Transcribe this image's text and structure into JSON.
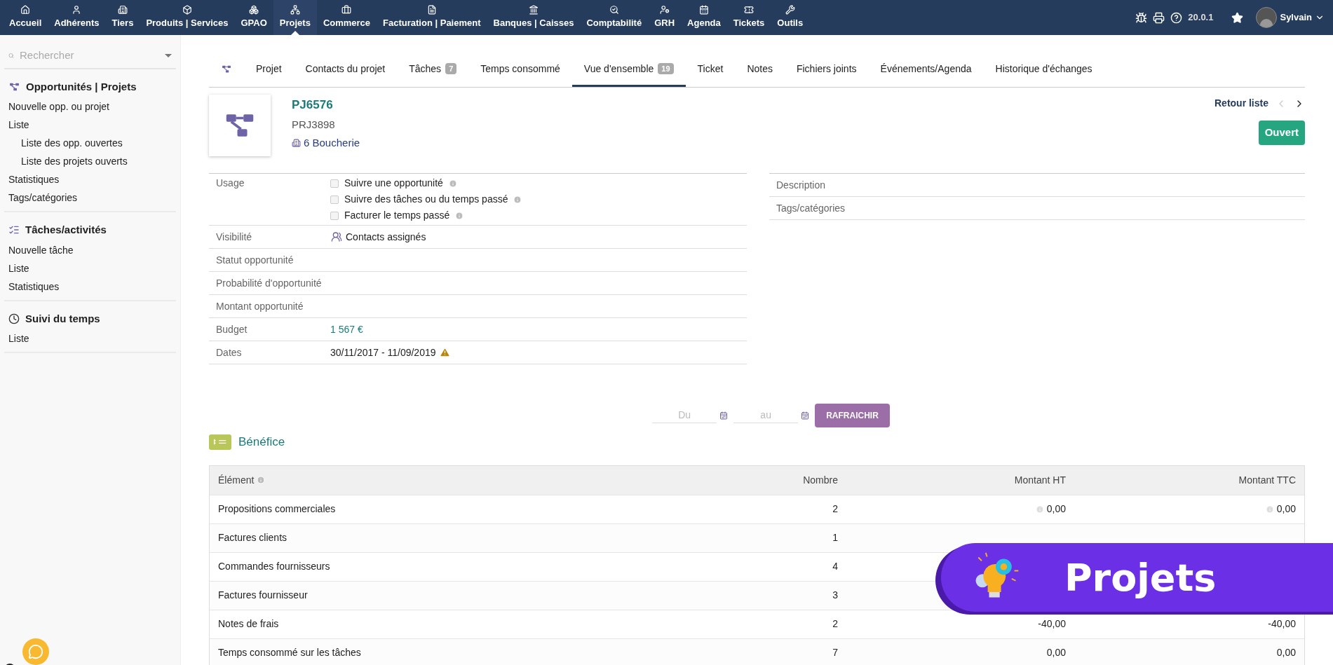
{
  "top_nav": {
    "items": [
      {
        "label": "Accueil",
        "selected": false
      },
      {
        "label": "Adhérents",
        "selected": false
      },
      {
        "label": "Tiers",
        "selected": false
      },
      {
        "label": "Produits | Services",
        "selected": false
      },
      {
        "label": "GPAO",
        "selected": false
      },
      {
        "label": "Projets",
        "selected": true
      },
      {
        "label": "Commerce",
        "selected": false
      },
      {
        "label": "Facturation | Paiement",
        "selected": false
      },
      {
        "label": "Banques | Caisses",
        "selected": false
      },
      {
        "label": "Comptabilité",
        "selected": false
      },
      {
        "label": "GRH",
        "selected": false
      },
      {
        "label": "Agenda",
        "selected": false
      },
      {
        "label": "Tickets",
        "selected": false
      },
      {
        "label": "Outils",
        "selected": false
      }
    ],
    "version": "20.0.1",
    "user": "Sylvain"
  },
  "sidebar": {
    "search": {
      "placeholder": "Rechercher"
    },
    "sections": [
      {
        "title": "Opportunités | Projets",
        "items": [
          {
            "label": "Nouvelle opp. ou projet"
          },
          {
            "label": "Liste",
            "children": [
              {
                "label": "Liste des opp. ouvertes"
              },
              {
                "label": "Liste des projets ouverts"
              }
            ]
          },
          {
            "label": "Statistiques"
          },
          {
            "label": "Tags/catégories"
          }
        ]
      },
      {
        "title": "Tâches/activités",
        "items": [
          {
            "label": "Nouvelle tâche"
          },
          {
            "label": "Liste"
          },
          {
            "label": "Statistiques"
          }
        ]
      },
      {
        "title": "Suivi du temps",
        "items": [
          {
            "label": "Liste"
          }
        ]
      }
    ]
  },
  "tabs": [
    {
      "kind": "icon",
      "selected": false
    },
    {
      "kind": "text",
      "label": "Projet",
      "selected": false
    },
    {
      "kind": "text",
      "label": "Contacts du projet",
      "selected": false
    },
    {
      "kind": "text",
      "label": "Tâches",
      "badge": "7",
      "selected": false
    },
    {
      "kind": "text",
      "label": "Temps consommé",
      "selected": false
    },
    {
      "kind": "text",
      "label": "Vue d'ensemble",
      "badge": "19",
      "selected": true
    },
    {
      "kind": "text",
      "label": "Ticket",
      "selected": false
    },
    {
      "kind": "text",
      "label": "Notes",
      "selected": false
    },
    {
      "kind": "text",
      "label": "Fichiers joints",
      "selected": false
    },
    {
      "kind": "text",
      "label": "Événements/Agenda",
      "selected": false
    },
    {
      "kind": "text",
      "label": "Historique d'échanges",
      "selected": false
    }
  ],
  "header": {
    "ref": "PJ6576",
    "title": "PRJ3898",
    "thirdparty": "6 Boucherie",
    "back_link": "Retour liste",
    "status": "Ouvert"
  },
  "fields_left": [
    {
      "kind": "checks",
      "label": "Usage",
      "options": [
        {
          "label": "Suivre une opportunité",
          "checked": false
        },
        {
          "label": "Suivre des tâches ou du temps passé",
          "checked": false
        },
        {
          "label": "Facturer le temps passé",
          "checked": false
        }
      ]
    },
    {
      "kind": "visibility",
      "label": "Visibilité",
      "value": "Contacts assignés"
    },
    {
      "kind": "text",
      "label": "Statut opportunité"
    },
    {
      "kind": "text",
      "label": "Probabilité d'opportunité"
    },
    {
      "kind": "text",
      "label": "Montant opportunité"
    },
    {
      "kind": "amount",
      "label": "Budget",
      "value": "1 567 €"
    },
    {
      "kind": "dates",
      "label": "Dates",
      "value": "30/11/2017 - 11/09/2019",
      "warning": true
    }
  ],
  "fields_right": [
    {
      "label": "Description"
    },
    {
      "label": "Tags/catégories"
    }
  ],
  "filter": {
    "from_placeholder": "Du",
    "to_placeholder": "au",
    "button": "RAFRAICHIR"
  },
  "section_title": "Bénéfice",
  "table": {
    "columns": [
      "Élément",
      "Nombre",
      "Montant HT",
      "Montant TTC"
    ],
    "rows": [
      {
        "element": "Propositions commerciales",
        "count": "2",
        "ht": "0,00",
        "ttc": "0,00",
        "info": true
      },
      {
        "element": "Factures clients",
        "count": "1"
      },
      {
        "element": "Commandes fournisseurs",
        "count": "4"
      },
      {
        "element": "Factures fournisseur",
        "count": "3"
      },
      {
        "element": "Notes de frais",
        "count": "2",
        "ht": "-40,00",
        "ttc": "-40,00",
        "info": false
      },
      {
        "element": "Temps consommé sur les tâches",
        "count": "7",
        "ht": "0,00",
        "ttc": "0,00",
        "info": false
      }
    ]
  },
  "banner": {
    "label": "Projets"
  }
}
